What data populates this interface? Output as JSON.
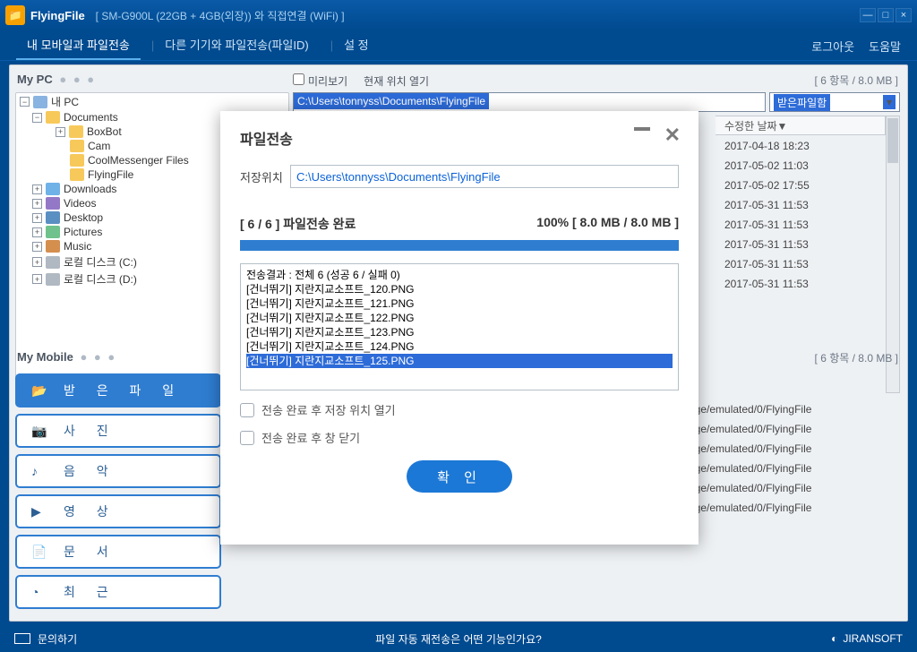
{
  "app": {
    "name": "FlyingFile",
    "device": "[ SM-G900L (22GB + 4GB(외장)) 와 직접연결 (WiFi) ]"
  },
  "tabs": {
    "t1": "내 모바일과 파일전송",
    "t2": "다른 기기와 파일전송(파일ID)",
    "t3": "설 정",
    "logout": "로그아웃",
    "help": "도움말"
  },
  "mypc": {
    "title": "My PC",
    "dots": "● ● ●"
  },
  "tree": {
    "root": "내 PC",
    "docs": "Documents",
    "boxbot": "BoxBot",
    "cam": "Cam",
    "cool": "CoolMessenger Files",
    "ff": "FlyingFile",
    "dl": "Downloads",
    "vid": "Videos",
    "desk": "Desktop",
    "pic": "Pictures",
    "mus": "Music",
    "c": "로컬 디스크 (C:)",
    "d": "로컬 디스크 (D:)"
  },
  "toolbar": {
    "preview": "미리보기",
    "openloc": "현재 위치 열기",
    "count": "[ 6 항목  /  8.0 MB ]",
    "path": "C:\\Users\\tonnyss\\Documents\\FlyingFile",
    "inbox": "받은파일함"
  },
  "listhdr": {
    "date": "수정한 날짜▼"
  },
  "dates": [
    "2017-04-18 18:23",
    "2017-05-02 11:03",
    "2017-05-02 17:55",
    "2017-05-31 11:53",
    "2017-05-31 11:53",
    "2017-05-31 11:53",
    "2017-05-31 11:53",
    "2017-05-31 11:53"
  ],
  "mobile": {
    "title": "My Mobile",
    "dots": "● ● ●",
    "count": "[ 6 항목  /  8.0 MB ]",
    "paths": [
      "age/emulated/0/FlyingFile",
      "age/emulated/0/FlyingFile",
      "age/emulated/0/FlyingFile",
      "age/emulated/0/FlyingFile",
      "age/emulated/0/FlyingFile",
      "age/emulated/0/FlyingFile"
    ]
  },
  "sidebtns": {
    "received": "받 은 파 일",
    "photo": "사        진",
    "music": "음        악",
    "video": "영        상",
    "doc": "문        서",
    "recent": "최        근"
  },
  "footer": {
    "contact": "문의하기",
    "mid": "파일 자동 재전송은 어떤 기능인가요?",
    "brand": "JIRANSOFT"
  },
  "modal": {
    "title": "파일전송",
    "locLabel": "저장위치",
    "locPath": "C:\\Users\\tonnyss\\Documents\\FlyingFile",
    "progL": "[ 6 / 6 ]  파일전송 완료",
    "progR": "100%  [ 8.0 MB / 8.0 MB ]",
    "log": [
      "전송결과 : 전체 6 (성공 6 / 실패 0)",
      "[건너뛰기] 지란지교소프트_120.PNG",
      "[건너뛰기] 지란지교소프트_121.PNG",
      "[건너뛰기] 지란지교소프트_122.PNG",
      "[건너뛰기] 지란지교소프트_123.PNG",
      "[건너뛰기] 지란지교소프트_124.PNG",
      "[건너뛰기] 지란지교소프트_125.PNG"
    ],
    "chk1": "전송 완료 후 저장 위치 열기",
    "chk2": "전송 완료 후 창 닫기",
    "ok": "확 인"
  }
}
